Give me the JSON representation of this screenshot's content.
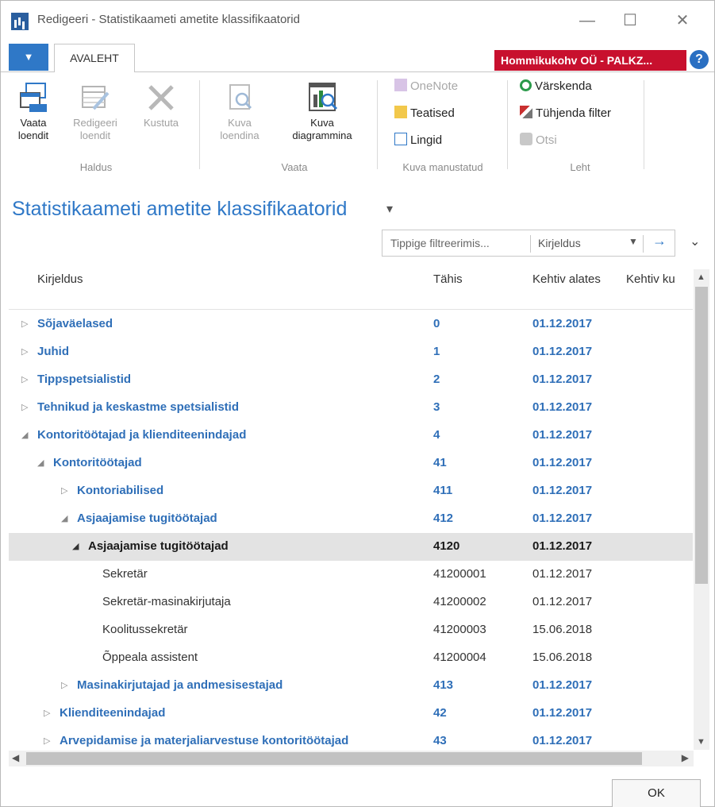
{
  "window": {
    "title": "Redigeeri - Statistikaameti ametite klassifikaatorid",
    "controls": {
      "minimize": "—",
      "maximize": "☐",
      "close": "✕"
    }
  },
  "tabs": {
    "file_glyph": "▼",
    "active": "AVALEHT"
  },
  "company": "Hommikukohv OÜ - PALKZ...",
  "help": "?",
  "ribbon": {
    "haldus": {
      "label": "Haldus",
      "vaata_loendit": [
        "Vaata",
        "loendit"
      ],
      "redigeeri_loendit": [
        "Redigeeri",
        "loendit"
      ],
      "kustuta": "Kustuta"
    },
    "vaata": {
      "label": "Vaata",
      "kuva_loendina": [
        "Kuva",
        "loendina"
      ],
      "kuva_diagrammina": [
        "Kuva",
        "diagrammina"
      ]
    },
    "manustatud": {
      "label": "Kuva manustatud",
      "onenote": "OneNote",
      "teatised": "Teatised",
      "lingid": "Lingid"
    },
    "leht": {
      "label": "Leht",
      "varskenda": "Värskenda",
      "tuhjenda": "Tühjenda filter",
      "otsi": "Otsi"
    }
  },
  "page_title": "Statistikaameti ametite klassifikaatorid",
  "title_dropdown": "▾",
  "filter": {
    "placeholder": "Tippige filtreerimis...",
    "field": "Kirjeldus",
    "caret": "▼",
    "go": "→",
    "collapse": "⌄"
  },
  "columns": {
    "kirjeldus": "Kirjeldus",
    "tahis": "Tähis",
    "kehtiv_alates": "Kehtiv alates",
    "kehtiv_kuni": "Kehtiv ku"
  },
  "rows": [
    {
      "expander": "▷",
      "kirjeldus": "Sõjaväelased",
      "tahis": "0",
      "kehtiv": "01.12.2017"
    },
    {
      "expander": "▷",
      "kirjeldus": "Juhid",
      "tahis": "1",
      "kehtiv": "01.12.2017"
    },
    {
      "expander": "▷",
      "kirjeldus": "Tippspetsialistid",
      "tahis": "2",
      "kehtiv": "01.12.2017"
    },
    {
      "expander": "▷",
      "kirjeldus": "Tehnikud ja keskastme spetsialistid",
      "tahis": "3",
      "kehtiv": "01.12.2017"
    },
    {
      "expander": "◢",
      "kirjeldus": "Kontoritöötajad ja klienditeenindajad",
      "tahis": "4",
      "kehtiv": "01.12.2017"
    },
    {
      "expander": "◢",
      "kirjeldus": "Kontoritöötajad",
      "tahis": "41",
      "kehtiv": "01.12.2017"
    },
    {
      "expander": "▷",
      "kirjeldus": "Kontoriabilised",
      "tahis": "411",
      "kehtiv": "01.12.2017"
    },
    {
      "expander": "◢",
      "kirjeldus": "Asjaajamise tugitöötajad",
      "tahis": "412",
      "kehtiv": "01.12.2017"
    },
    {
      "expander": "◢",
      "kirjeldus": "Asjaajamise tugitöötajad",
      "tahis": "4120",
      "kehtiv": "01.12.2017"
    },
    {
      "expander": "",
      "kirjeldus": "Sekretär",
      "tahis": "41200001",
      "kehtiv": "01.12.2017"
    },
    {
      "expander": "",
      "kirjeldus": "Sekretär-masinakirjutaja",
      "tahis": "41200002",
      "kehtiv": "01.12.2017"
    },
    {
      "expander": "",
      "kirjeldus": "Koolitussekretär",
      "tahis": "41200003",
      "kehtiv": "15.06.2018"
    },
    {
      "expander": "",
      "kirjeldus": "Õppeala assistent",
      "tahis": "41200004",
      "kehtiv": "15.06.2018"
    },
    {
      "expander": "▷",
      "kirjeldus": "Masinakirjutajad ja andmesisestajad",
      "tahis": "413",
      "kehtiv": "01.12.2017"
    },
    {
      "expander": "▷",
      "kirjeldus": "Klienditeenindajad",
      "tahis": "42",
      "kehtiv": "01.12.2017"
    },
    {
      "expander": "▷",
      "kirjeldus": "Arvepidamise ja materjaliarvestuse kontoritöötajad",
      "tahis": "43",
      "kehtiv": "01.12.2017"
    }
  ],
  "scroll": {
    "up": "▲",
    "down": "▼",
    "left": "◀",
    "right": "▶"
  },
  "ok": "OK",
  "colors": {
    "accent": "#2f78c7",
    "company_badge": "#c8102e",
    "selected_row": "#e3e3e3"
  }
}
